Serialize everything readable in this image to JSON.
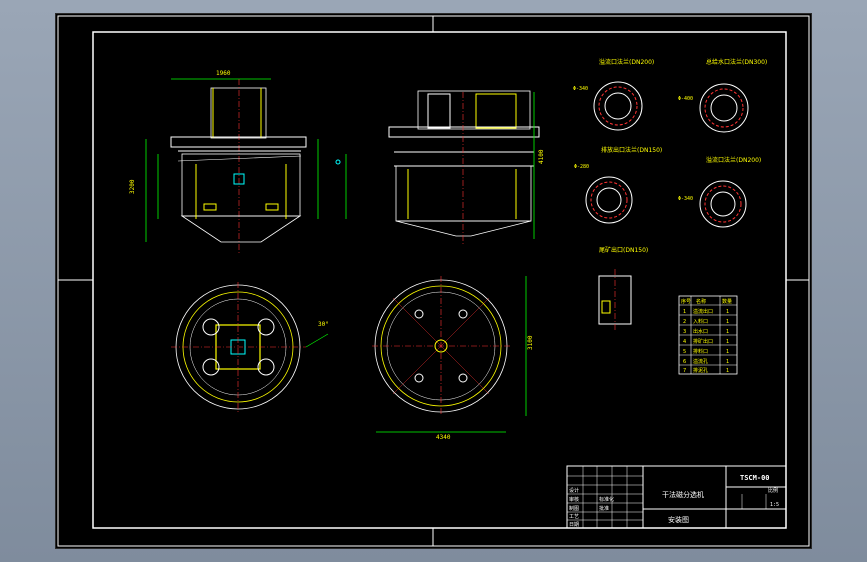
{
  "drawing": {
    "flange_titles": [
      "溢流口法兰(DN200)",
      "总给水口法兰(DN300)",
      "排放出口法兰(DN150)",
      "溢流口法兰(DN200)",
      "尾矿出口(DN150)"
    ],
    "dims": {
      "top_width": "1960",
      "front_height": "3200",
      "tall_height": "4100",
      "plan_width": "4340",
      "plan_height": "3100",
      "angle": "30°"
    },
    "pcd": [
      "Φ-340",
      "Φ-400",
      "Φ-280",
      "Φ-340"
    ],
    "bom": {
      "header": [
        "序号",
        "名称",
        "数量"
      ],
      "rows": [
        [
          "1",
          "溢流出口",
          "1"
        ],
        [
          "2",
          "入料口",
          "1"
        ],
        [
          "3",
          "出水口",
          "1"
        ],
        [
          "4",
          "排矿出口",
          "1"
        ],
        [
          "5",
          "排料口",
          "1"
        ],
        [
          "6",
          "溢流孔",
          "1"
        ],
        [
          "7",
          "排泥孔",
          "1"
        ]
      ]
    },
    "title_block": {
      "code": "TSCM-00",
      "name": "干法磁分选机",
      "sub": "安装图",
      "scale_label": "比例",
      "ratio": "1:5",
      "row_labels": [
        "设计",
        "审核",
        "制图",
        "工艺",
        "日期"
      ],
      "row_mid": [
        "标准化",
        "批准"
      ]
    }
  },
  "colors": {
    "bg": "#000000",
    "line": "#ffffff",
    "yellow": "#ffff00",
    "cyan": "#00ffff",
    "green": "#00ff00",
    "red": "#ff3030",
    "magenta": "#ff00ff"
  }
}
